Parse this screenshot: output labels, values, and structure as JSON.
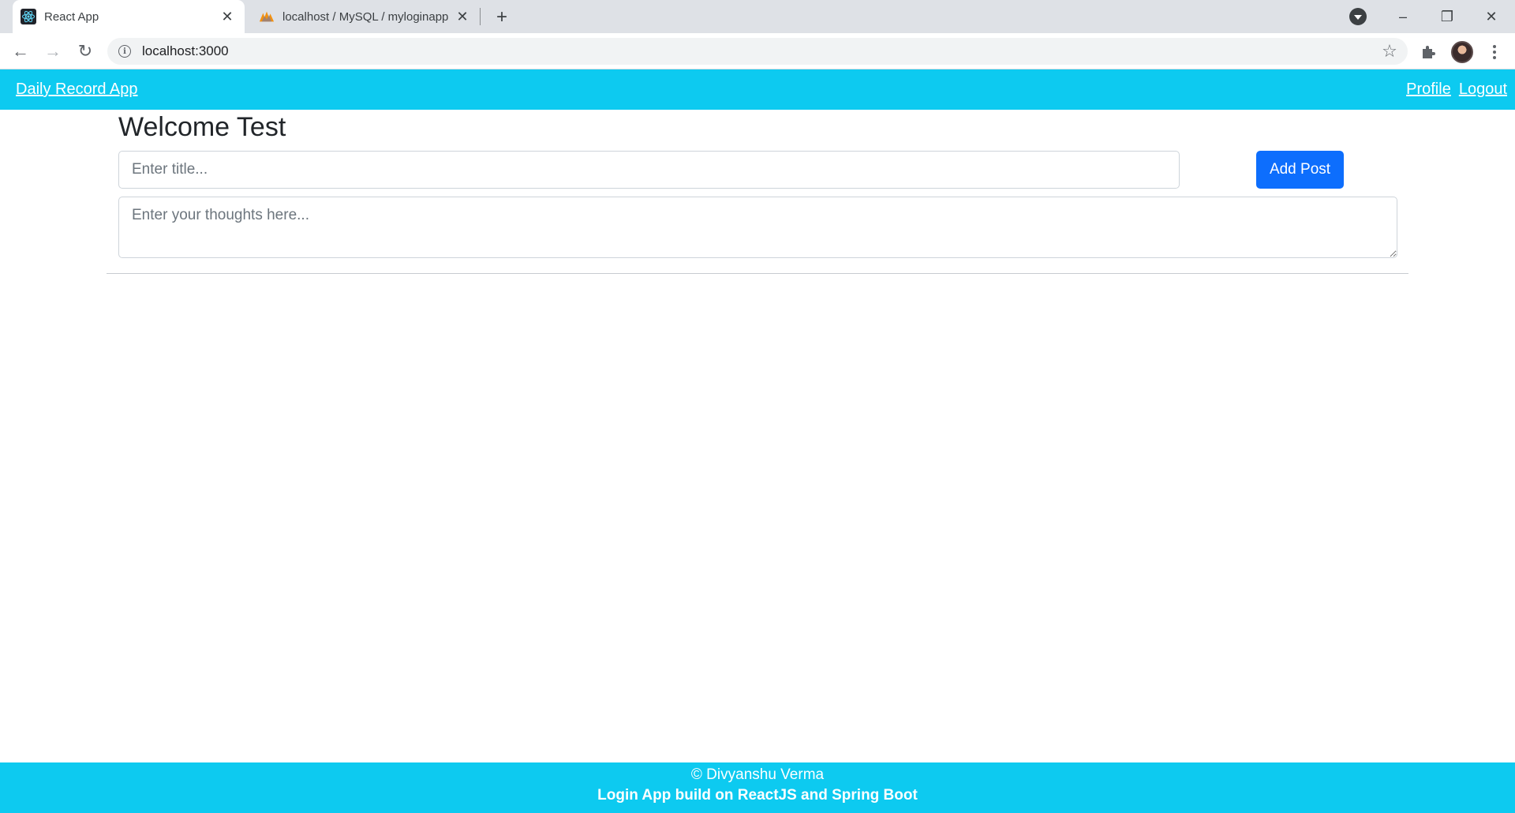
{
  "browser": {
    "tabs": [
      {
        "title": "React App",
        "favicon": "react-icon",
        "active": true
      },
      {
        "title": "localhost / MySQL / myloginapp",
        "favicon": "phpmyadmin-icon",
        "active": false
      }
    ],
    "close_glyph": "✕",
    "new_tab_glyph": "+",
    "url": "localhost:3000",
    "controls": {
      "minimize": "–",
      "restore": "❐",
      "close": "✕"
    },
    "nav": {
      "back": "←",
      "forward": "→",
      "reload": "↻"
    },
    "star_glyph": "☆"
  },
  "app": {
    "brand": "Daily Record App",
    "nav_links": {
      "profile": "Profile",
      "logout": "Logout"
    },
    "welcome": "Welcome Test",
    "form": {
      "title_placeholder": "Enter title...",
      "body_placeholder": "Enter your thoughts here...",
      "add_label": "Add Post"
    },
    "footer": {
      "line1": "© Divyanshu Verma",
      "line2": "Login App build on ReactJS and Spring Boot"
    }
  },
  "colors": {
    "nav_bg": "#0dcaf0",
    "primary_button": "#0d6efd"
  }
}
